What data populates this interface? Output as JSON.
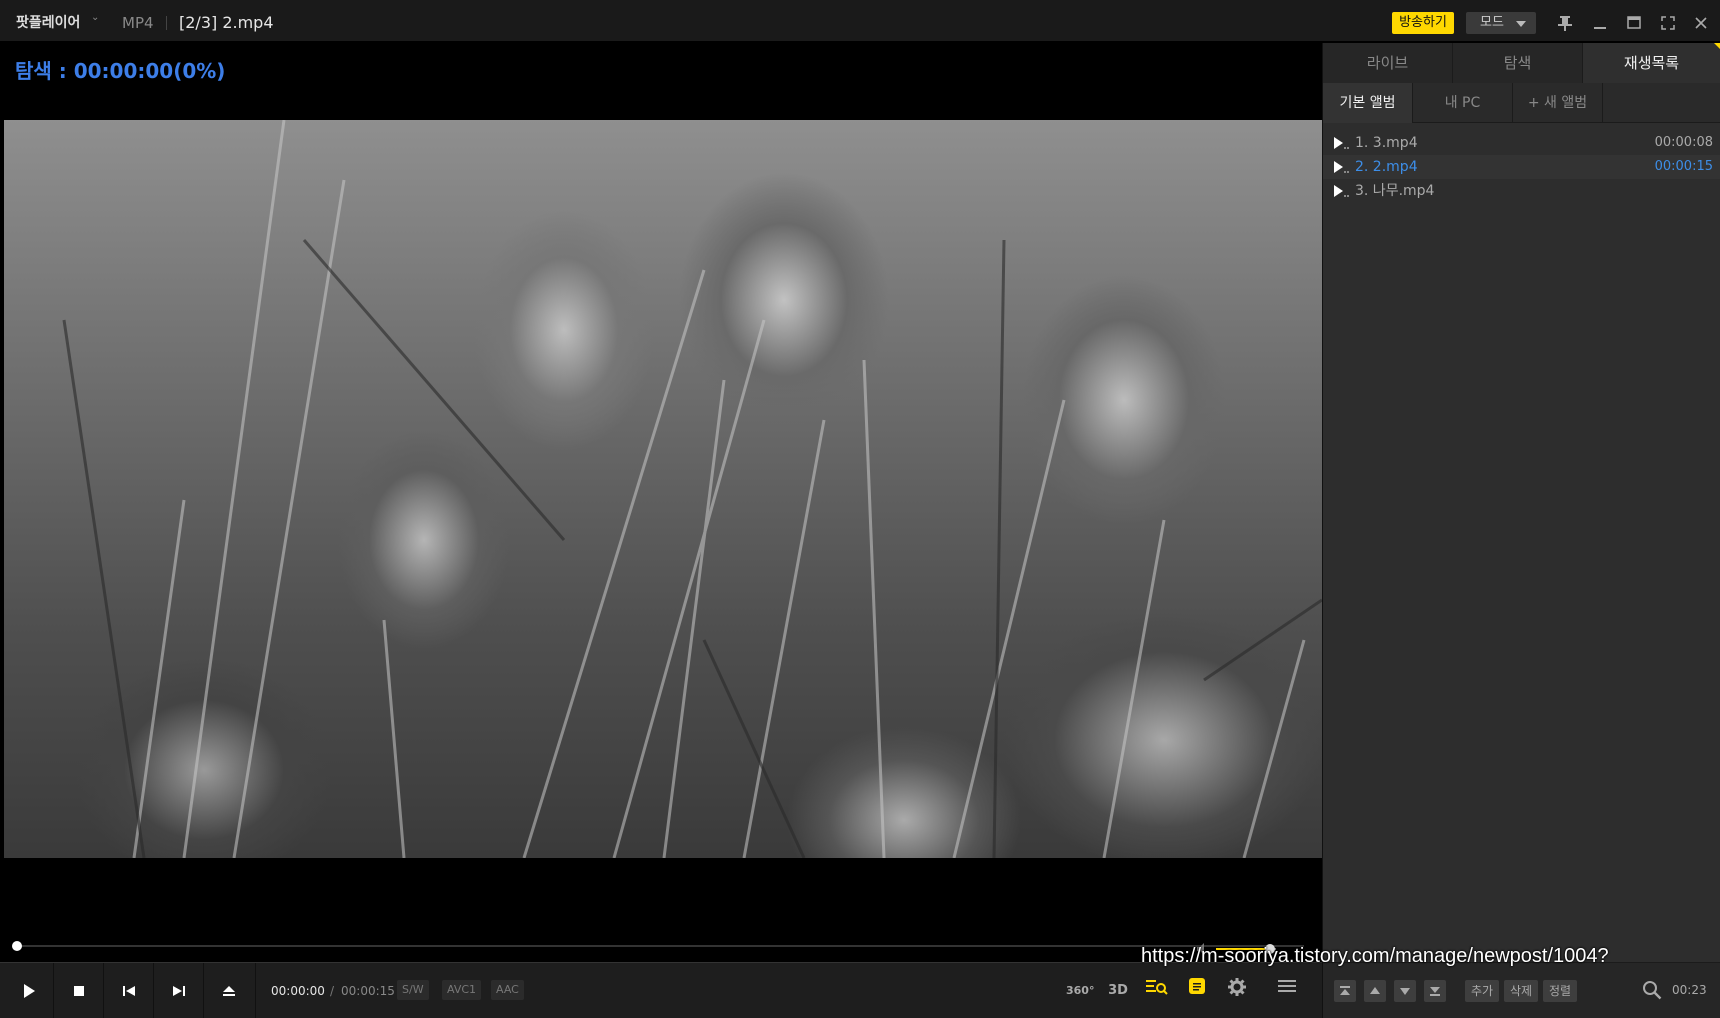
{
  "titlebar": {
    "app_name": "팟플레이어",
    "format": "MP4",
    "title": "[2/3] 2.mp4",
    "broadcast_label": "방송하기",
    "mode_label": "모드"
  },
  "seek_label": "탐색 : 00:00:00(0%)",
  "video": {
    "description": "grayscale reeds"
  },
  "progress": {
    "position": 0,
    "volume": 0.9
  },
  "controls": {
    "time_current": "00:00:00",
    "time_separator": "/",
    "time_total": "00:00:15",
    "tags": [
      "S/W",
      "AVC1",
      "AAC"
    ],
    "icon_360": "360°",
    "icon_3d": "3D"
  },
  "sidebar": {
    "tabs": [
      "라이브",
      "탐색",
      "재생목록"
    ],
    "active_tab": 2,
    "subtabs": [
      "기본 앨범",
      "내 PC",
      "+ 새 앨범"
    ],
    "playlist": [
      {
        "title": "1. 3.mp4",
        "duration": "00:00:08"
      },
      {
        "title": "2. 2.mp4",
        "duration": "00:00:15"
      },
      {
        "title": "3. 나무.mp4",
        "duration": ""
      }
    ],
    "bottom": {
      "add_label": "추가",
      "delete_label": "삭제",
      "sort_label": "정렬",
      "time": "00:23"
    }
  },
  "overlay_url": "https://m-sooriya.tistory.com/manage/newpost/1004?",
  "colors": {
    "accent_blue": "#3d7ee8",
    "accent_yellow": "#ffd800"
  }
}
